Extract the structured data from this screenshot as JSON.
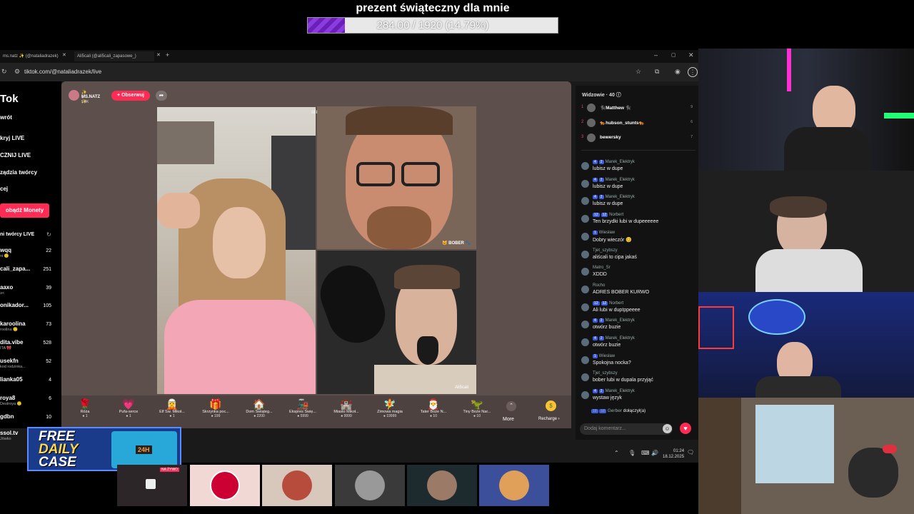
{
  "goal": {
    "title": "prezent świąteczny dla mnie",
    "progress_text": "284.00 / 1920 (14.79%)",
    "progress_fraction": 0.1479,
    "fill_color": "#7a2fd0"
  },
  "browser": {
    "tabs": [
      "ms.natz ✨ (@nataliadrazek)",
      "Ali5cali (@ali5cali_zapasowe_)"
    ],
    "new_tab_icon": "+",
    "url": "tiktok.com/@nataliadrazek/live"
  },
  "sidebar": {
    "logo": "Tok",
    "items": [
      "wrót",
      "kryj LIVE",
      "CZNIJ LIVE",
      "ządzia twórcy",
      "cej"
    ],
    "coins_button": "obądź Monety",
    "creators_header": "ni twórcy LIVE",
    "creators": [
      {
        "name": "wqq",
        "sub": "ni 🙂",
        "count": "22"
      },
      {
        "name": "cali_zapa...",
        "sub": "",
        "count": "251"
      },
      {
        "name": "aaxo",
        "sub": "≥<",
        "count": "39"
      },
      {
        "name": "onikador...",
        "sub": "",
        "count": "105"
      },
      {
        "name": "karoolina",
        "sub": "roolina 🙂",
        "count": "73"
      },
      {
        "name": "dita.vibe",
        "sub": "ITA 🎀",
        "count": "528"
      },
      {
        "name": "usekfn",
        "sub": "kod rodzinka...",
        "count": "52"
      },
      {
        "name": "lianka05",
        "sub": "",
        "count": "4"
      },
      {
        "name": "roya8",
        "sub": "Destroya 🙂",
        "count": "6"
      },
      {
        "name": "gdbn",
        "sub": "",
        "count": "10"
      },
      {
        "name": "ssol.tv",
        "sub": "Jówko",
        "count": ""
      }
    ]
  },
  "live": {
    "host_name": "✨ MS.NATZ ✨",
    "host_likes": "♥ 5.3K",
    "follow_label": "+ Obserwuj",
    "share_icon": "share-icon",
    "guest_top_tag": "🐱 BOBER 🐾",
    "guest_bottom_tag": "Ali5cali",
    "mute_icon": "ıılı"
  },
  "gifts": [
    {
      "icon": "🌹",
      "name": "Róża",
      "price": "1"
    },
    {
      "icon": "💗",
      "name": "Pufa-serce",
      "price": "1"
    },
    {
      "icon": "🧝",
      "name": "Elf Św. Mikoł...",
      "price": "1"
    },
    {
      "icon": "🎁",
      "name": "Skrzynka poc...",
      "price": "199"
    },
    {
      "icon": "🏠",
      "name": "Dom Świąteg...",
      "price": "2200"
    },
    {
      "icon": "🚂",
      "name": "Ekspres Świę...",
      "price": "5999"
    },
    {
      "icon": "🏰",
      "name": "Miasto Mikoł...",
      "price": "9999"
    },
    {
      "icon": "🧚",
      "name": "Zimowa magia",
      "price": "19999"
    },
    {
      "icon": "🎅",
      "name": "Tater Boże N...",
      "price": "10"
    },
    {
      "icon": "🦖",
      "name": "Tiny Boże Nar...",
      "price": "10"
    }
  ],
  "gift_more": "More",
  "gift_recharge": "Recharge ›",
  "chat": {
    "viewers_header": "Widzowie · 40 ⓘ",
    "viewers": [
      {
        "rank": "1",
        "name": "🐈‍⬛Matthew 🐈‍⬛",
        "score": "9"
      },
      {
        "rank": "2",
        "name": "🐅hubson_stunts🐅",
        "score": "6"
      },
      {
        "rank": "3",
        "name": "bewersky",
        "score": "7"
      }
    ],
    "messages": [
      {
        "badges": [
          "4",
          "2"
        ],
        "user": "Marek_Elektryk",
        "text": "lubisz w dupe"
      },
      {
        "badges": [
          "4",
          "2"
        ],
        "user": "Marek_Elektryk",
        "text": "lubisz w dupe"
      },
      {
        "badges": [
          "4",
          "2"
        ],
        "user": "Marek_Elektryk",
        "text": "lubisz w dupe"
      },
      {
        "badges": [
          "12",
          "12"
        ],
        "user": "Norbert",
        "text": "Ten brzydki lubi w dupeeeeee"
      },
      {
        "badges": [
          "1"
        ],
        "user": "Wiesław",
        "text": "Dobry wieczór 😊"
      },
      {
        "badges": [],
        "user": "Tjet_szybszy",
        "text": "aliścali to cipa jakaś"
      },
      {
        "badges": [],
        "user": "Matro_Sr",
        "text": "XDDD"
      },
      {
        "badges": [],
        "user": "Rocho",
        "text": "ADRES BOBER KURWO"
      },
      {
        "badges": [
          "12",
          "12"
        ],
        "user": "Norbert",
        "text": "Ali lubi w dupIppeeee"
      },
      {
        "badges": [
          "4",
          "2"
        ],
        "user": "Marek_Elektryk",
        "text": "otwórz buzie"
      },
      {
        "badges": [
          "4",
          "2"
        ],
        "user": "Marek_Elektryk",
        "text": "otwórz buzie"
      },
      {
        "badges": [
          "1"
        ],
        "user": "Wiesław",
        "text": "Spokojna nocka?"
      },
      {
        "badges": [],
        "user": "Tjet_szybszy",
        "text": "bober lubi w dupala przyjąć"
      },
      {
        "badges": [
          "4",
          "2"
        ],
        "user": "Marek_Elektryk",
        "text": "wystaw język"
      }
    ],
    "join_user": "Gerber",
    "join_text": "dołączył(a)",
    "join_badges": [
      "18",
      "18"
    ],
    "input_placeholder": "Dodaj komentarz...",
    "emoji_icon": "☺",
    "heart_icon": "♥"
  },
  "taskbar": {
    "time": "01:24",
    "date": "18.12.2025"
  },
  "promo": {
    "line1": "FREE",
    "line2": "DAILY",
    "line3": "CASE",
    "badge": "24H"
  },
  "strip": {
    "first_label": "NA ŻYWO"
  }
}
